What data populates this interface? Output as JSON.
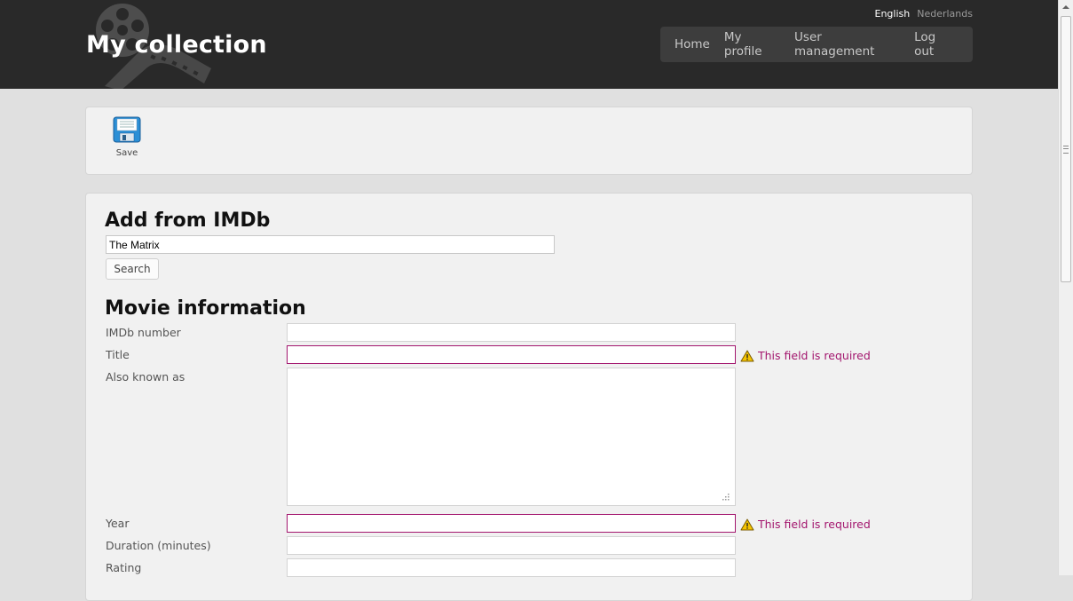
{
  "header": {
    "site_title": "My collection",
    "languages": {
      "english": "English",
      "dutch": "Nederlands"
    },
    "nav": {
      "home": "Home",
      "my_profile": "My profile",
      "user_management": "User management",
      "log_out": "Log out"
    },
    "icons": {
      "logo": "film-reel-icon"
    }
  },
  "toolbar": {
    "save_label": "Save",
    "save_icon": "floppy-disk-icon"
  },
  "imdb_search": {
    "heading": "Add from IMDb",
    "query_value": "The Matrix",
    "search_label": "Search"
  },
  "movie_info": {
    "heading": "Movie information",
    "fields": {
      "imdb_number": {
        "label": "IMDb number",
        "value": ""
      },
      "title": {
        "label": "Title",
        "value": "",
        "error": "This field is required"
      },
      "also_known_as": {
        "label": "Also known as",
        "value": ""
      },
      "year": {
        "label": "Year",
        "value": "",
        "error": "This field is required"
      },
      "duration": {
        "label": "Duration (minutes)",
        "value": ""
      },
      "rating": {
        "label": "Rating",
        "value": ""
      }
    },
    "error_icon": "warning-icon"
  },
  "colors": {
    "header_bg": "#292929",
    "nav_bg": "#3d3d3d",
    "error": "#a3166e",
    "page_bg": "#e0e0e0",
    "panel_bg": "#f1f1f1"
  }
}
